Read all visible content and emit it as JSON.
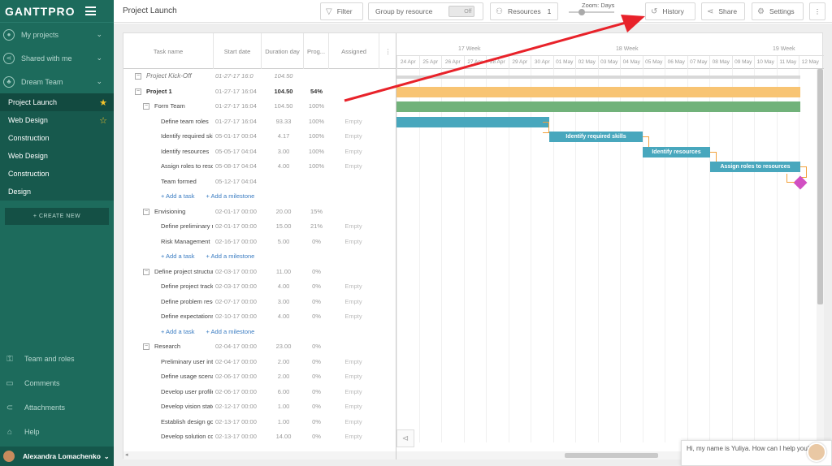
{
  "app": {
    "logo": "GANTTPRO"
  },
  "sidebar": {
    "groups": [
      {
        "label": "My projects",
        "icon": "person-icon"
      },
      {
        "label": "Shared with me",
        "icon": "share-icon"
      },
      {
        "label": "Dream Team",
        "icon": "team-icon"
      }
    ],
    "projects": [
      {
        "label": "Project Launch",
        "star": "★"
      },
      {
        "label": "Web Design",
        "star": "☆"
      },
      {
        "label": "Construction"
      },
      {
        "label": "Web Design"
      },
      {
        "label": "Construction"
      },
      {
        "label": "Design"
      }
    ],
    "create_label": "+ CREATE NEW",
    "bottom": [
      {
        "label": "Team and roles",
        "icon": "roles-icon"
      },
      {
        "label": "Comments",
        "icon": "comment-icon"
      },
      {
        "label": "Attachments",
        "icon": "attachment-icon"
      },
      {
        "label": "Help",
        "icon": "help-icon"
      }
    ],
    "user": "Alexandra Lomachenko"
  },
  "topbar": {
    "title": "Project Launch",
    "filter": "Filter",
    "group_by": "Group by resource",
    "toggle": "Off",
    "resources": "Resources",
    "resources_count": "1",
    "zoom": "Zoom: Days",
    "history": "History",
    "share": "Share",
    "settings": "Settings"
  },
  "grid": {
    "headers": [
      "Task name",
      "Start date",
      "Duration day",
      "Prog...",
      "Assigned"
    ],
    "rows": [
      {
        "name": "Project Kick-Off",
        "start": "01-27-17 16:0",
        "dur": "104.50",
        "prog": "",
        "asg": "",
        "type": "kick",
        "indent": 0,
        "toggle": "−"
      },
      {
        "name": "Project 1",
        "start": "01-27-17 16:04",
        "dur": "104.50",
        "prog": "54%",
        "asg": "",
        "type": "bold",
        "indent": 1,
        "toggle": "−"
      },
      {
        "name": "Form Team",
        "start": "01-27-17 16:04",
        "dur": "104.50",
        "prog": "100%",
        "asg": "",
        "type": "group",
        "indent": 2,
        "toggle": "−"
      },
      {
        "name": "Define team roles",
        "start": "01-27-17 16:04",
        "dur": "93.33",
        "prog": "100%",
        "asg": "Empty",
        "indent": 3
      },
      {
        "name": "Identify required skills",
        "start": "05-01-17 00:04",
        "dur": "4.17",
        "prog": "100%",
        "asg": "Empty",
        "indent": 3
      },
      {
        "name": "Identify resources",
        "start": "05-05-17 04:04",
        "dur": "3.00",
        "prog": "100%",
        "asg": "Empty",
        "indent": 3
      },
      {
        "name": "Assign roles to resources",
        "start": "05-08-17 04:04",
        "dur": "4.00",
        "prog": "100%",
        "asg": "Empty",
        "indent": 3
      },
      {
        "name": "Team formed",
        "start": "05-12-17 04:04",
        "dur": "",
        "prog": "",
        "asg": "",
        "indent": 3
      },
      {
        "type": "add",
        "indent": 3
      },
      {
        "name": "Envisioning",
        "start": "02-01-17 00:00",
        "dur": "20.00",
        "prog": "15%",
        "asg": "",
        "type": "group",
        "indent": 2,
        "toggle": "−"
      },
      {
        "name": "Define preliminary resources",
        "start": "02-01-17 00:00",
        "dur": "15.00",
        "prog": "21%",
        "asg": "Empty",
        "indent": 3
      },
      {
        "name": "Risk Management",
        "start": "02-16-17 00:00",
        "dur": "5.00",
        "prog": "0%",
        "asg": "Empty",
        "indent": 3
      },
      {
        "type": "add",
        "indent": 3
      },
      {
        "name": "Define project structure",
        "start": "02-03-17 00:00",
        "dur": "11.00",
        "prog": "0%",
        "asg": "",
        "type": "group",
        "indent": 2,
        "toggle": "−"
      },
      {
        "name": "Define project tracking",
        "start": "02-03-17 00:00",
        "dur": "4.00",
        "prog": "0%",
        "asg": "Empty",
        "indent": 3
      },
      {
        "name": "Define problem resolution",
        "start": "02-07-17 00:00",
        "dur": "3.00",
        "prog": "0%",
        "asg": "Empty",
        "indent": 3
      },
      {
        "name": "Define expectations",
        "start": "02-10-17 00:00",
        "dur": "4.00",
        "prog": "0%",
        "asg": "Empty",
        "indent": 3
      },
      {
        "type": "add",
        "indent": 3
      },
      {
        "name": "Research",
        "start": "02-04-17 00:00",
        "dur": "23.00",
        "prog": "0%",
        "asg": "",
        "type": "group",
        "indent": 2,
        "toggle": "−"
      },
      {
        "name": "Preliminary user interviews",
        "start": "02-04-17 00:00",
        "dur": "2.00",
        "prog": "0%",
        "asg": "Empty",
        "indent": 3
      },
      {
        "name": "Define usage scenarios",
        "start": "02-06-17 00:00",
        "dur": "2.00",
        "prog": "0%",
        "asg": "Empty",
        "indent": 3
      },
      {
        "name": "Develop user profiles",
        "start": "02-06-17 00:00",
        "dur": "6.00",
        "prog": "0%",
        "asg": "Empty",
        "indent": 3
      },
      {
        "name": "Develop vision statement",
        "start": "02-12-17 00:00",
        "dur": "1.00",
        "prog": "0%",
        "asg": "Empty",
        "indent": 3
      },
      {
        "name": "Establish design goals",
        "start": "02-13-17 00:00",
        "dur": "1.00",
        "prog": "0%",
        "asg": "Empty",
        "indent": 3
      },
      {
        "name": "Develop solution concepts",
        "start": "02-13-17 00:00",
        "dur": "14.00",
        "prog": "0%",
        "asg": "Empty",
        "indent": 3
      }
    ],
    "add_task": "+ Add a task",
    "add_milestone": "+ Add a milestone"
  },
  "timeline": {
    "weeks": [
      "17 Week",
      "18 Week",
      "19 Week"
    ],
    "days": [
      "24 Apr",
      "25 Apr",
      "26 Apr",
      "27 Apr",
      "28 Apr",
      "29 Apr",
      "30 Apr",
      "01 May",
      "02 May",
      "03 May",
      "04 May",
      "05 May",
      "06 May",
      "07 May",
      "08 May",
      "09 May",
      "10 May",
      "11 May",
      "12 May"
    ],
    "bars": [
      {
        "row": 1,
        "color": "#f8c473",
        "label": ""
      },
      {
        "row": 2,
        "color": "#71b27a",
        "label": ""
      },
      {
        "row": 3,
        "color": "#48a7bd",
        "label": ""
      },
      {
        "row": 4,
        "color": "#48a7bd",
        "label": "Identify required skills"
      },
      {
        "row": 5,
        "color": "#48a7bd",
        "label": "Identify resources"
      },
      {
        "row": 6,
        "color": "#48a7bd",
        "label": "Assign roles to resources"
      }
    ],
    "milestone_color": "#d14fc2"
  },
  "chat": {
    "text": "Hi, my name is Yuliya. How can I help you?"
  }
}
